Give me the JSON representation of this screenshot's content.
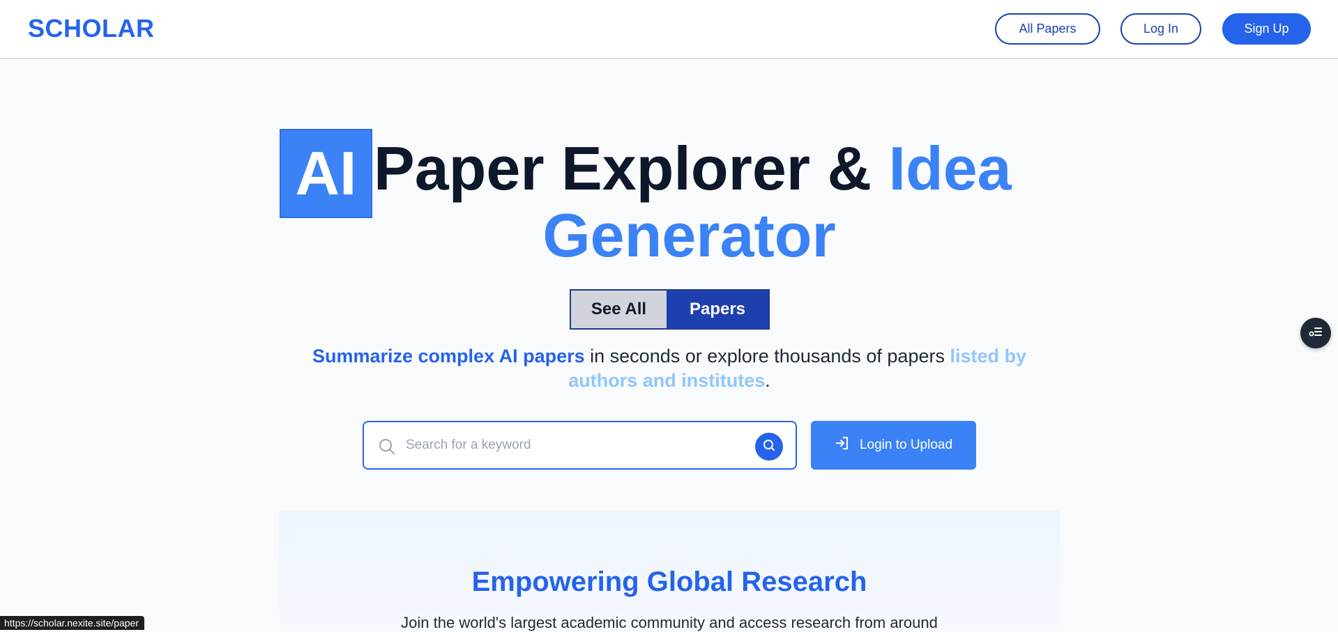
{
  "nav": {
    "logo": "SCHOLAR",
    "all_papers": "All Papers",
    "login": "Log In",
    "signup": "Sign Up"
  },
  "hero": {
    "ai_box": "AI",
    "row1_text": "Paper Explorer & ",
    "row1_accent": "Idea",
    "row2_accent": "Generator"
  },
  "toggle": {
    "see_all": "See All",
    "papers": "Papers"
  },
  "subtitle": {
    "part1": "Summarize complex AI papers",
    "part2": " in seconds or explore thousands of papers ",
    "part3": "listed by authors and institutes",
    "part4": "."
  },
  "search": {
    "placeholder": "Search for a keyword",
    "value": ""
  },
  "upload": {
    "label": "Login to Upload"
  },
  "research": {
    "title": "Empowering Global Research",
    "text": "Join the world's largest academic community and access research from around"
  },
  "status_bar": {
    "url": "https://scholar.nexite.site/paper"
  },
  "colors": {
    "primary": "#2563eb",
    "accent": "#3b82f6",
    "dark_navy": "#1e40af",
    "light_accent": "#93c5fd"
  },
  "icons": {
    "search_left": "search-icon",
    "search_go": "search-icon",
    "upload": "login-arrow-icon",
    "fab": "list-settings-icon"
  }
}
